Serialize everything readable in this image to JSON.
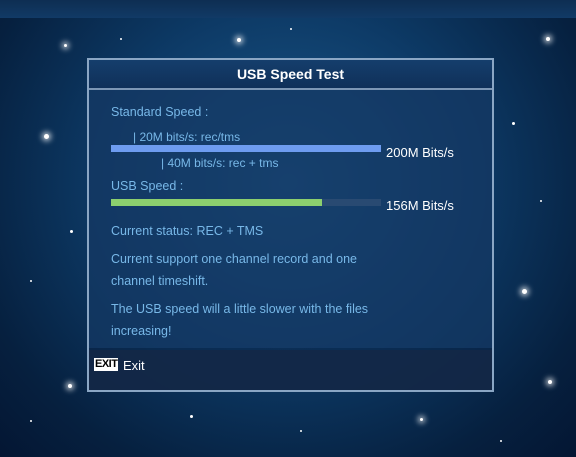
{
  "dialog": {
    "title": "USB Speed Test",
    "standard_label": "Standard Speed :",
    "line_20": "| 20M bits/s: rec/tms",
    "line_40": "| 40M bits/s: rec + tms",
    "standard_value": "200M Bits/s",
    "standard_fill": 1.0,
    "usb_label": "USB Speed :",
    "usb_value": "156M Bits/s",
    "usb_fill": 0.78,
    "status": "Current status: REC + TMS",
    "support_line1": "Current support one channel record and one",
    "support_line2": "channel timeshift.",
    "note_line1": "The USB speed will a little slower with the files",
    "note_line2": "increasing!"
  },
  "footer": {
    "exit_key": "EXIT",
    "exit_label": "Exit"
  },
  "colors": {
    "standard_bar": "#6e9cf0",
    "usb_bar": "#8ccf6e",
    "text": "#78b8e8"
  }
}
